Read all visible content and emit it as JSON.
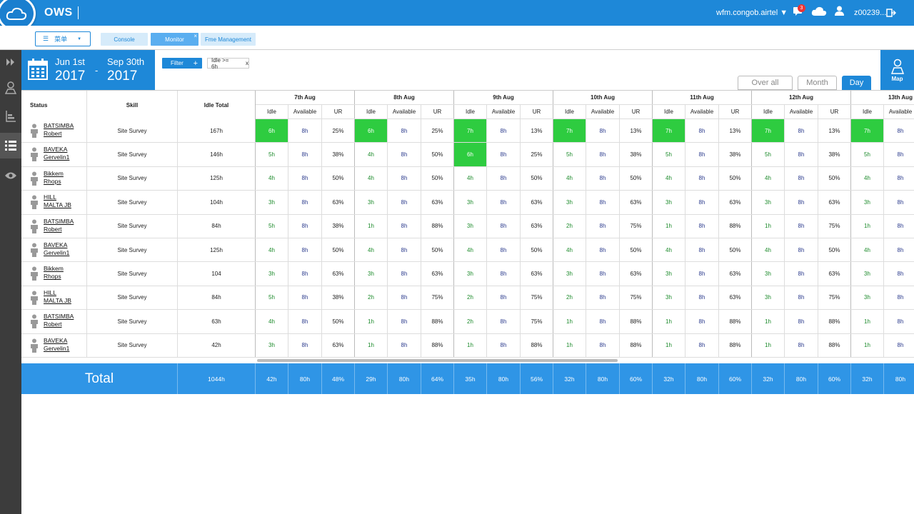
{
  "app": {
    "name": "OWS",
    "domain": "wfm.congob.airtel",
    "user": "z00239...",
    "notif_count": "3"
  },
  "nav": {
    "menu_label": "菜单",
    "tabs": [
      {
        "label": "Console"
      },
      {
        "label": "Monitor"
      },
      {
        "label": "Fme Management"
      }
    ]
  },
  "date_range": {
    "from_day": "Jun 1st",
    "from_year": "2017",
    "dash": "-",
    "to_day": "Sep 30th",
    "to_year": "2017"
  },
  "filter": {
    "label": "Filter",
    "chip": "Idle >= 6h",
    "chip_close": "x"
  },
  "views": {
    "overall": "Over all",
    "month": "Month",
    "day": "Day"
  },
  "map_label": "Map",
  "table": {
    "col_status": "Status",
    "col_skill": "Skill",
    "col_idle_total": "Idle Total",
    "sub_headers": [
      "Idle",
      "Available",
      "UR"
    ],
    "days": [
      "7th Aug",
      "8th Aug",
      "9th Aug",
      "10th Aug",
      "11th Aug",
      "12th Aug",
      "13th Aug"
    ],
    "rows": [
      {
        "first": "BATSIMBA",
        "last": "Robert",
        "skill": "Site Survey",
        "total": "167h",
        "cells": [
          [
            "6h",
            "8h",
            "25%"
          ],
          [
            "6h",
            "8h",
            "25%"
          ],
          [
            "7h",
            "8h",
            "13%"
          ],
          [
            "7h",
            "8h",
            "13%"
          ],
          [
            "7h",
            "8h",
            "13%"
          ],
          [
            "7h",
            "8h",
            "13%"
          ],
          [
            "7h",
            "8h",
            ""
          ]
        ],
        "hl": [
          true,
          true,
          true,
          true,
          true,
          true,
          true
        ]
      },
      {
        "first": "BAVEKA",
        "last": "Gervelin1",
        "skill": "Site Survey",
        "total": "146h",
        "cells": [
          [
            "5h",
            "8h",
            "38%"
          ],
          [
            "4h",
            "8h",
            "50%"
          ],
          [
            "6h",
            "8h",
            "25%"
          ],
          [
            "5h",
            "8h",
            "38%"
          ],
          [
            "5h",
            "8h",
            "38%"
          ],
          [
            "5h",
            "8h",
            "38%"
          ],
          [
            "5h",
            "8h",
            ""
          ]
        ],
        "hl": [
          false,
          false,
          true,
          false,
          false,
          false,
          false
        ]
      },
      {
        "first": "Bikkem",
        "last": "Rhops",
        "skill": "Site Survey",
        "total": "125h",
        "cells": [
          [
            "4h",
            "8h",
            "50%"
          ],
          [
            "4h",
            "8h",
            "50%"
          ],
          [
            "4h",
            "8h",
            "50%"
          ],
          [
            "4h",
            "8h",
            "50%"
          ],
          [
            "4h",
            "8h",
            "50%"
          ],
          [
            "4h",
            "8h",
            "50%"
          ],
          [
            "4h",
            "8h",
            ""
          ]
        ],
        "hl": [
          false,
          false,
          false,
          false,
          false,
          false,
          false
        ]
      },
      {
        "first": "HILL",
        "last": "MALTA JB",
        "skill": "Site Survey",
        "total": "104h",
        "cells": [
          [
            "3h",
            "8h",
            "63%"
          ],
          [
            "3h",
            "8h",
            "63%"
          ],
          [
            "3h",
            "8h",
            "63%"
          ],
          [
            "3h",
            "8h",
            "63%"
          ],
          [
            "3h",
            "8h",
            "63%"
          ],
          [
            "3h",
            "8h",
            "63%"
          ],
          [
            "3h",
            "8h",
            ""
          ]
        ],
        "hl": [
          false,
          false,
          false,
          false,
          false,
          false,
          false
        ]
      },
      {
        "first": "BATSIMBA",
        "last": "Robert",
        "skill": "Site Survey",
        "total": "84h",
        "cells": [
          [
            "5h",
            "8h",
            "38%"
          ],
          [
            "1h",
            "8h",
            "88%"
          ],
          [
            "3h",
            "8h",
            "63%"
          ],
          [
            "2h",
            "8h",
            "75%"
          ],
          [
            "1h",
            "8h",
            "88%"
          ],
          [
            "1h",
            "8h",
            "75%"
          ],
          [
            "1h",
            "8h",
            ""
          ]
        ],
        "hl": [
          false,
          false,
          false,
          false,
          false,
          false,
          false
        ]
      },
      {
        "first": "BAVEKA",
        "last": "Gervelin1",
        "skill": "Site Survey",
        "total": "125h",
        "cells": [
          [
            "4h",
            "8h",
            "50%"
          ],
          [
            "4h",
            "8h",
            "50%"
          ],
          [
            "4h",
            "8h",
            "50%"
          ],
          [
            "4h",
            "8h",
            "50%"
          ],
          [
            "4h",
            "8h",
            "50%"
          ],
          [
            "4h",
            "8h",
            "50%"
          ],
          [
            "4h",
            "8h",
            ""
          ]
        ],
        "hl": [
          false,
          false,
          false,
          false,
          false,
          false,
          false
        ]
      },
      {
        "first": "Bikkem",
        "last": "Rhops",
        "skill": "Site Survey",
        "total": "104",
        "cells": [
          [
            "3h",
            "8h",
            "63%"
          ],
          [
            "3h",
            "8h",
            "63%"
          ],
          [
            "3h",
            "8h",
            "63%"
          ],
          [
            "3h",
            "8h",
            "63%"
          ],
          [
            "3h",
            "8h",
            "63%"
          ],
          [
            "3h",
            "8h",
            "63%"
          ],
          [
            "3h",
            "8h",
            ""
          ]
        ],
        "hl": [
          false,
          false,
          false,
          false,
          false,
          false,
          false
        ]
      },
      {
        "first": "HILL",
        "last": "MALTA JB",
        "skill": "Site Survey",
        "total": "84h",
        "cells": [
          [
            "5h",
            "8h",
            "38%"
          ],
          [
            "2h",
            "8h",
            "75%"
          ],
          [
            "2h",
            "8h",
            "75%"
          ],
          [
            "2h",
            "8h",
            "75%"
          ],
          [
            "3h",
            "8h",
            "63%"
          ],
          [
            "3h",
            "8h",
            "75%"
          ],
          [
            "3h",
            "8h",
            ""
          ]
        ],
        "hl": [
          false,
          false,
          false,
          false,
          false,
          false,
          false
        ]
      },
      {
        "first": "BATSIMBA",
        "last": "Robert",
        "skill": "Site Survey",
        "total": "63h",
        "cells": [
          [
            "4h",
            "8h",
            "50%"
          ],
          [
            "1h",
            "8h",
            "88%"
          ],
          [
            "2h",
            "8h",
            "75%"
          ],
          [
            "1h",
            "8h",
            "88%"
          ],
          [
            "1h",
            "8h",
            "88%"
          ],
          [
            "1h",
            "8h",
            "88%"
          ],
          [
            "1h",
            "8h",
            ""
          ]
        ],
        "hl": [
          false,
          false,
          false,
          false,
          false,
          false,
          false
        ]
      },
      {
        "first": "BAVEKA",
        "last": "Gervelin1",
        "skill": "Site Survey",
        "total": "42h",
        "cells": [
          [
            "3h",
            "8h",
            "63%"
          ],
          [
            "1h",
            "8h",
            "88%"
          ],
          [
            "1h",
            "8h",
            "88%"
          ],
          [
            "1h",
            "8h",
            "88%"
          ],
          [
            "1h",
            "8h",
            "88%"
          ],
          [
            "1h",
            "8h",
            "88%"
          ],
          [
            "1h",
            "8h",
            ""
          ]
        ],
        "hl": [
          false,
          false,
          false,
          false,
          false,
          false,
          false
        ]
      }
    ]
  },
  "totals": {
    "label": "Total",
    "idle_total": "1044h",
    "cells": [
      "42h",
      "80h",
      "48%",
      "29h",
      "80h",
      "64%",
      "35h",
      "80h",
      "56%",
      "32h",
      "80h",
      "60%",
      "32h",
      "80h",
      "60%",
      "32h",
      "80h",
      "60%",
      "32h",
      "80h"
    ]
  },
  "colors": {
    "primary": "#1e88d8",
    "highlight": "#2ecc40",
    "sidebar": "#3c3c3c"
  }
}
